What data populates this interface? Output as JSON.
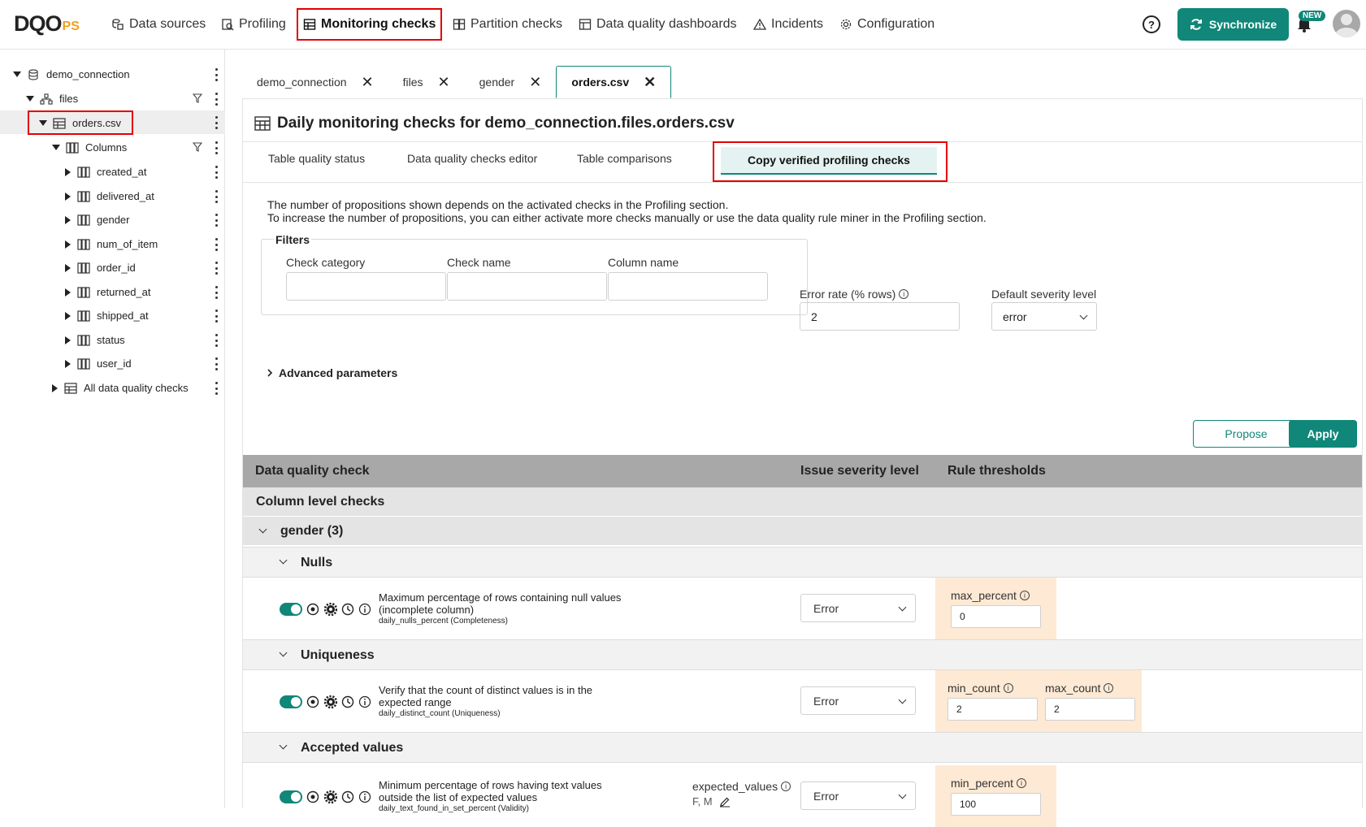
{
  "app": {
    "logo_main": "DQO",
    "logo_sub": "PS"
  },
  "nav": {
    "data_sources": "Data sources",
    "profiling": "Profiling",
    "monitoring_checks": "Monitoring checks",
    "partition_checks": "Partition checks",
    "dashboards": "Data quality dashboards",
    "incidents": "Incidents",
    "configuration": "Configuration",
    "synchronize": "Synchronize",
    "new_badge": "NEW",
    "help": "?"
  },
  "tree": {
    "connection": "demo_connection",
    "schema": "files",
    "table": "orders.csv",
    "columns_label": "Columns",
    "columns": [
      "created_at",
      "delivered_at",
      "gender",
      "num_of_item",
      "order_id",
      "returned_at",
      "shipped_at",
      "status",
      "user_id"
    ],
    "all_checks": "All data quality checks"
  },
  "tabs": [
    {
      "label": "demo_connection"
    },
    {
      "label": "files"
    },
    {
      "label": "gender"
    },
    {
      "label": "orders.csv"
    }
  ],
  "page": {
    "title": "Daily monitoring checks for demo_connection.files.orders.csv",
    "subtabs": [
      "Table quality status",
      "Data quality checks editor",
      "Table comparisons",
      "Copy verified profiling checks"
    ],
    "info_line1": "The number of propositions shown depends on the activated checks in the Profiling section.",
    "info_line2": "To increase the number of propositions, you can either activate more checks manually or use the data quality rule miner in the Profiling section.",
    "filters": {
      "legend": "Filters",
      "check_category": "Check category",
      "check_name": "Check name",
      "column_name": "Column name"
    },
    "error_rate_label": "Error rate (% rows)",
    "error_rate_value": "2",
    "severity_label": "Default severity level",
    "severity_value": "error",
    "advanced": "Advanced parameters",
    "propose": "Propose",
    "apply": "Apply"
  },
  "table": {
    "h_check": "Data quality check",
    "h_severity": "Issue severity level",
    "h_thresholds": "Rule thresholds",
    "column_level": "Column level checks",
    "group": "gender (3)",
    "categories": {
      "nulls": "Nulls",
      "uniqueness": "Uniqueness",
      "accepted": "Accepted values"
    },
    "checks": {
      "nulls": {
        "desc1": "Maximum percentage of rows containing null values",
        "desc2": "(incomplete column)",
        "name": "daily_nulls_percent (Completeness)",
        "severity": "Error",
        "param_label": "max_percent",
        "param_value": "0"
      },
      "distinct": {
        "desc1": "Verify that the count of distinct values is in the",
        "desc2": "expected range",
        "name": "daily_distinct_count (Uniqueness)",
        "severity": "Error",
        "min_label": "min_count",
        "min_value": "2",
        "max_label": "max_count",
        "max_value": "2"
      },
      "in_set": {
        "desc1": "Minimum percentage of rows having text values",
        "desc2": "outside the list of expected values",
        "name": "daily_text_found_in_set_percent (Validity)",
        "extra_label": "expected_values",
        "extra_value": "F, M",
        "severity": "Error",
        "param_label": "min_percent",
        "param_value": "100"
      }
    }
  }
}
